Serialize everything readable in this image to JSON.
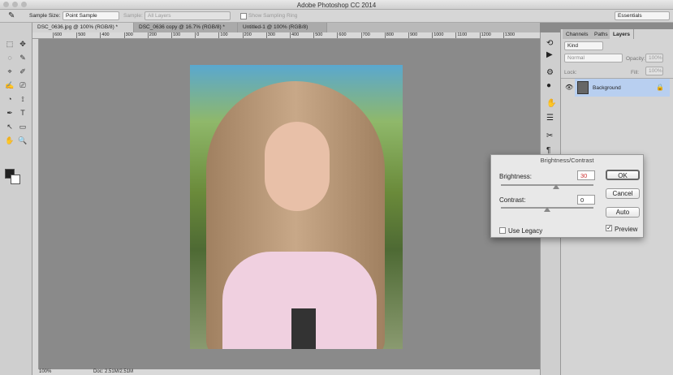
{
  "window": {
    "title": "Adobe Photoshop CC 2014"
  },
  "options": {
    "sample_size_label": "Sample Size:",
    "sample_size_value": "Point Sample",
    "sample_label": "Sample:",
    "sample_value": "All Layers",
    "sampling_ring": "Show Sampling Ring",
    "workspace": "Essentials"
  },
  "tabs": [
    {
      "label": "DSC_0636.jpg @ 100% (RGB/8) *",
      "active": true
    },
    {
      "label": "DSC_0636 copy @ 16.7% (RGB/8) *"
    },
    {
      "label": "Untitled-1 @ 100% (RGB/8)"
    }
  ],
  "ruler": [
    "600",
    "500",
    "400",
    "300",
    "200",
    "100",
    "0",
    "100",
    "200",
    "300",
    "400",
    "500",
    "600",
    "700",
    "800",
    "900",
    "1000",
    "1100",
    "1200",
    "1300"
  ],
  "status": {
    "zoom": "100%",
    "doc": "Doc: 2.51M/2.51M"
  },
  "layers_panel": {
    "tabs": [
      "Channels",
      "Paths",
      "Layers"
    ],
    "kind": "Kind",
    "blend": "Normal",
    "opacity_label": "Opacity:",
    "opacity": "100%",
    "lock_label": "Lock:",
    "fill_label": "Fill:",
    "fill": "100%",
    "layer_name": "Background"
  },
  "dialog": {
    "title": "Brightness/Contrast",
    "brightness_label": "Brightness:",
    "brightness": "30",
    "contrast_label": "Contrast:",
    "contrast": "0",
    "ok": "OK",
    "cancel": "Cancel",
    "auto": "Auto",
    "use_legacy": "Use Legacy",
    "preview": "Preview",
    "brightness_fraction": 0.6,
    "contrast_fraction": 0.5
  }
}
